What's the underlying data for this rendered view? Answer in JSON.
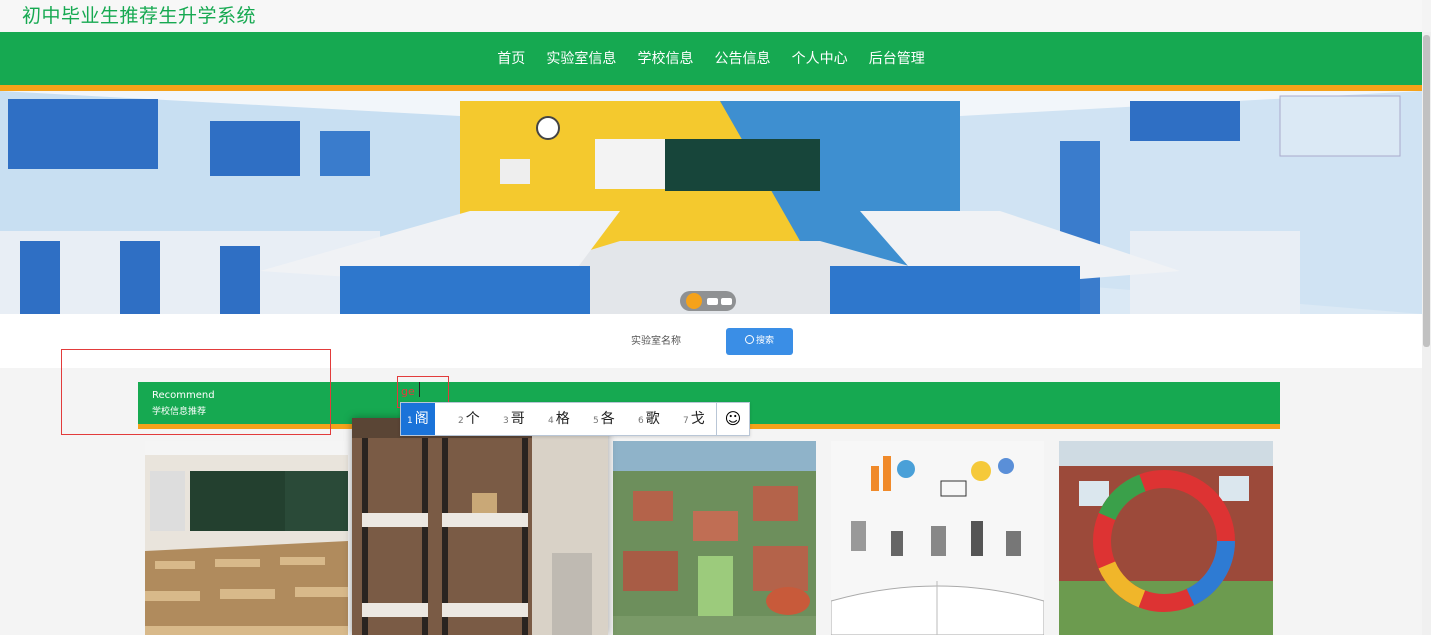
{
  "header": {
    "site_title": "初中毕业生推荐生升学系统"
  },
  "nav": {
    "items": [
      {
        "label": "首页"
      },
      {
        "label": "实验室信息"
      },
      {
        "label": "学校信息"
      },
      {
        "label": "公告信息"
      },
      {
        "label": "个人中心"
      },
      {
        "label": "后台管理"
      }
    ]
  },
  "search": {
    "label": "实验室名称",
    "button_label": "搜索"
  },
  "section": {
    "title_en": "Recommend",
    "title_cn": "学校信息推荐"
  },
  "ime": {
    "typed": "ge",
    "candidates": [
      {
        "num": "1",
        "char": "阁"
      },
      {
        "num": "2",
        "char": "个"
      },
      {
        "num": "3",
        "char": "哥"
      },
      {
        "num": "4",
        "char": "格"
      },
      {
        "num": "5",
        "char": "各"
      },
      {
        "num": "6",
        "char": "歌"
      },
      {
        "num": "7",
        "char": "戈"
      }
    ],
    "emoji": "☺"
  },
  "colors": {
    "brand_green": "#16a951",
    "accent_orange": "#f5a21a",
    "button_blue": "#3a8ee6",
    "ime_highlight": "#1a73d9"
  },
  "carousel": {
    "slide_count": 3,
    "active_index": 0
  }
}
